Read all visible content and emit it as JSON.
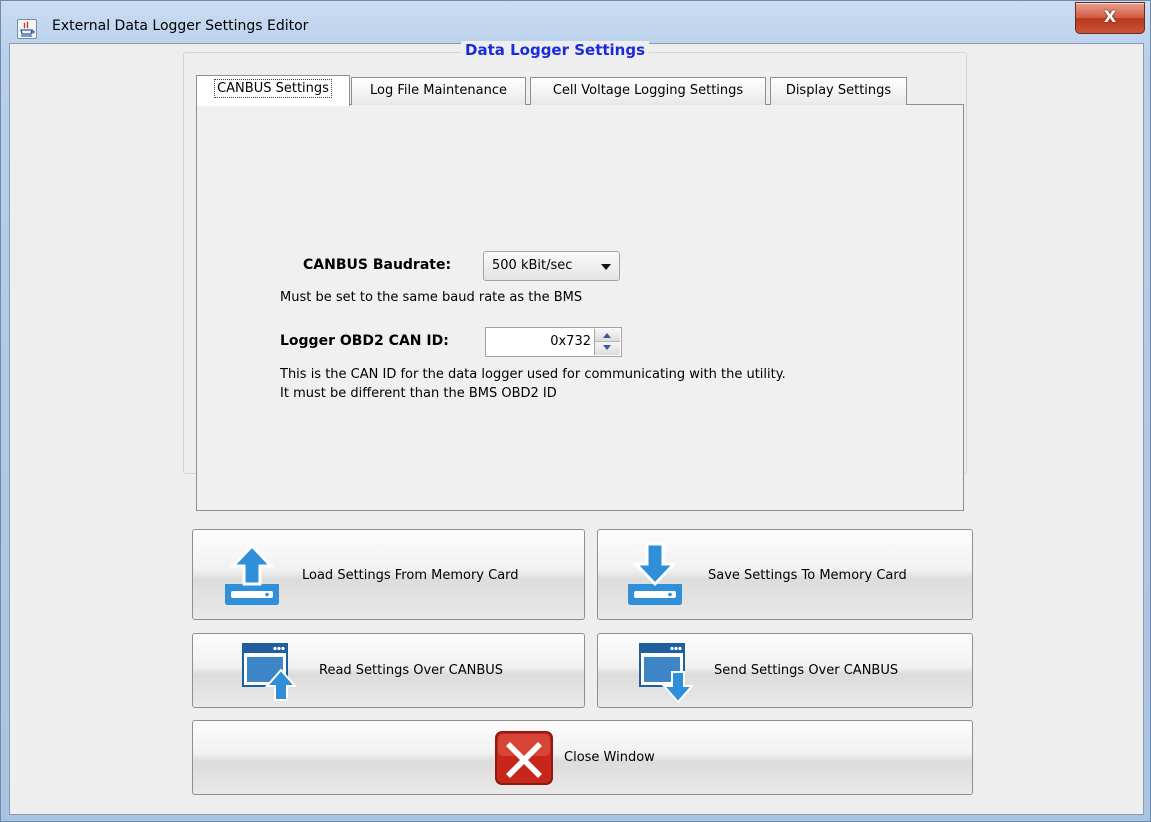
{
  "window": {
    "title": "External Data Logger Settings Editor",
    "close_glyph": "X",
    "icon": "java-app-icon"
  },
  "group": {
    "title": "Data Logger Settings"
  },
  "tabs": [
    {
      "label": "CANBUS Settings",
      "active": true
    },
    {
      "label": "Log File Maintenance",
      "active": false
    },
    {
      "label": "Cell Voltage Logging Settings",
      "active": false
    },
    {
      "label": "Display Settings",
      "active": false
    }
  ],
  "canbus": {
    "baudrate_label": "CANBUS Baudrate:",
    "baudrate_value": "500 kBit/sec",
    "baudrate_hint": "Must be set to the same baud rate as the BMS",
    "obd2_label": "Logger OBD2 CAN ID:",
    "obd2_value": "0x732",
    "obd2_hint_line1": "This is the CAN ID for the data logger used for communicating with the utility.",
    "obd2_hint_line2": "It must be different than the BMS OBD2 ID"
  },
  "buttons": {
    "load": "Load Settings From Memory Card",
    "save": "Save Settings To Memory Card",
    "read": "Read Settings Over CANBUS",
    "send": "Send Settings Over CANBUS",
    "close": "Close Window"
  },
  "colors": {
    "group_title": "#1a2bd9",
    "icon_blue": "#2f8fd8",
    "close_red": "#c8261b"
  }
}
